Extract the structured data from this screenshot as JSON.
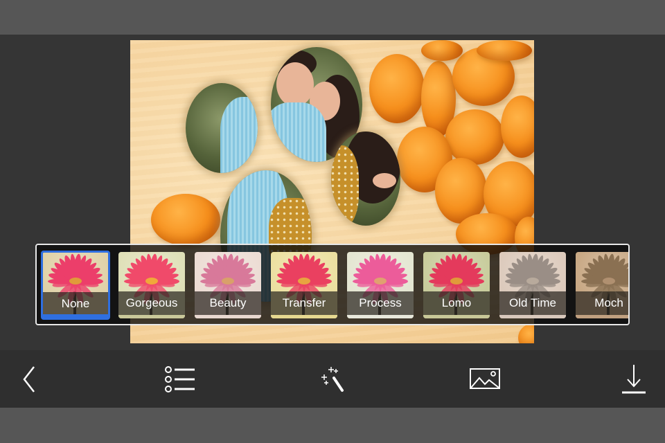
{
  "editor": {
    "canvas": {
      "description": "Photo collage: four-petal flower frame with couple photo over wooden background with dried apricots"
    },
    "filters": {
      "selected": "None",
      "items": [
        {
          "label": "None",
          "tint": "#e0d2a8",
          "petal": "#ec3e6a",
          "core": "#e09a3a",
          "bottom": "#2f6fe0"
        },
        {
          "label": "Gorgeous",
          "tint": "#dfe0b8",
          "petal": "#f04a6a",
          "core": "#f0a83a",
          "bottom": "#c9c89a"
        },
        {
          "label": "Beauty",
          "tint": "#ecdcd4",
          "petal": "#d8799a",
          "core": "#d9a06a",
          "bottom": "#e8d8d0"
        },
        {
          "label": "Transfer",
          "tint": "#ece0a0",
          "petal": "#ea4060",
          "core": "#e8a440",
          "bottom": "#e6d890"
        },
        {
          "label": "Process",
          "tint": "#e4e6d2",
          "petal": "#ec5c9a",
          "core": "#e0a070",
          "bottom": "#e8e8dc"
        },
        {
          "label": "Lomo",
          "tint": "#c8cc9c",
          "petal": "#e43a5c",
          "core": "#e09a3a",
          "bottom": "#c8c898"
        },
        {
          "label": "Old Time",
          "tint": "#dccabc",
          "petal": "#9a8e86",
          "core": "#b8aa9c",
          "bottom": "#d8c8bc"
        },
        {
          "label": "Moch",
          "tint": "#c8a884",
          "petal": "#8a7052",
          "core": "#b09070",
          "bottom": "#c0a080"
        }
      ]
    }
  },
  "toolbar": {
    "items": [
      {
        "name": "back",
        "icon": "chevron-left-icon"
      },
      {
        "name": "frames-list",
        "icon": "list-icon"
      },
      {
        "name": "effects",
        "icon": "magic-wand-icon"
      },
      {
        "name": "background",
        "icon": "image-icon"
      },
      {
        "name": "save",
        "icon": "download-icon"
      }
    ]
  },
  "colors": {
    "accent": "#2f6fe0",
    "toolbar_bg": "#2f2f2f",
    "workspace_bg": "#353535",
    "chrome_bg": "#565656",
    "icon": "#ffffff"
  }
}
